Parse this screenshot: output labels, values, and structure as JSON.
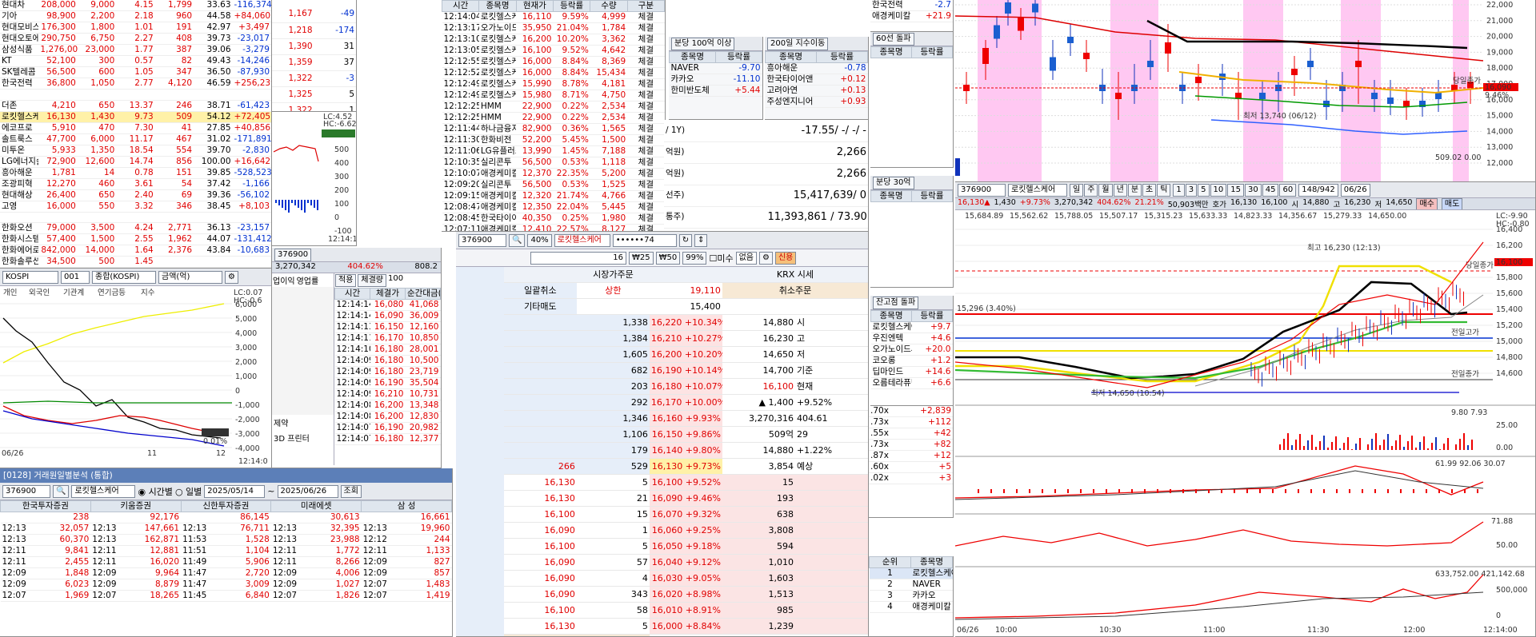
{
  "colors": {
    "up": "#e00000",
    "down": "#0030d0",
    "accent": "#5c7fb8"
  },
  "stocks": {
    "rows": [
      [
        "현대차",
        "208,000",
        "9,000",
        "4.15",
        "1,799",
        "33.63",
        "-116,374"
      ],
      [
        "기아",
        "98,900",
        "2,200",
        "2.18",
        "960",
        "44.58",
        "+84,060"
      ],
      [
        "현대모비스",
        "176,300",
        "1,800",
        "1.01",
        "191",
        "42.97",
        "+3,497"
      ],
      [
        "현대오토에버",
        "290,750",
        "6,750",
        "2.27",
        "408",
        "39.73",
        "-23,017"
      ],
      [
        "삼성식품",
        "1,276,000",
        "23,000",
        "1.77",
        "387",
        "39.06",
        "-3,279"
      ],
      [
        "KT",
        "52,100",
        "300",
        "0.57",
        "82",
        "49.43",
        "-14,246"
      ],
      [
        "SK텔레콤",
        "56,500",
        "600",
        "1.05",
        "347",
        "36.50",
        "-87,930"
      ],
      [
        "한국전력",
        "36,800",
        "1,050",
        "2.77",
        "4,120",
        "46.59",
        "+256,239"
      ],
      [
        "",
        "",
        "",
        "",
        "",
        "",
        ""
      ],
      [
        "더존",
        "4,210",
        "650",
        "13.37",
        "246",
        "38.71",
        "-61,423"
      ],
      [
        "로킷헬스케어",
        "16,130",
        "1,430",
        "9.73",
        "509",
        "54.12",
        "+72,405"
      ],
      [
        "에코프로",
        "5,910",
        "470",
        "7.30",
        "41",
        "27.85",
        "+40,856"
      ],
      [
        "솔트룩스",
        "47,700",
        "6,000",
        "11.17",
        "467",
        "31.02",
        "-171,891"
      ],
      [
        "미투온",
        "5,933",
        "1,350",
        "18.54",
        "554",
        "39.70",
        "-2,830"
      ],
      [
        "LG에너지솔루션",
        "72,900",
        "12,600",
        "14.74",
        "856",
        "100.00",
        "+16,642"
      ],
      [
        "흥아해운",
        "1,781",
        "14",
        "0.78",
        "151",
        "39.85",
        "-528,523"
      ],
      [
        "조광피혁",
        "12,270",
        "460",
        "3.61",
        "54",
        "37.42",
        "-1,166"
      ],
      [
        "현대해상",
        "26,400",
        "650",
        "2.40",
        "69",
        "39.36",
        "-56,102"
      ],
      [
        "고영",
        "16,000",
        "550",
        "3.32",
        "346",
        "38.45",
        "+8,103"
      ],
      [
        "",
        "",
        "",
        "",
        "",
        "",
        ""
      ],
      [
        "한화오션",
        "79,000",
        "3,500",
        "4.24",
        "2,771",
        "36.13",
        "-23,157"
      ],
      [
        "한화시스템",
        "57,400",
        "1,500",
        "2.55",
        "1,962",
        "44.07",
        "-131,412"
      ],
      [
        "한화에어로스페이스",
        "842,000",
        "14,000",
        "1.64",
        "2,376",
        "43.84",
        "-10,683"
      ],
      [
        "한화솔루션",
        "34,500",
        "500",
        "1.45",
        "",
        "",
        ""
      ]
    ],
    "side_vals": [
      [
        "1,167",
        "-49"
      ],
      [
        "1,218",
        "-174"
      ],
      [
        "1,390",
        "31"
      ],
      [
        "1,359",
        "37"
      ],
      [
        "1,322",
        "-3"
      ],
      [
        "1,325",
        "5"
      ],
      [
        "1,322",
        "1"
      ]
    ]
  },
  "mini": {
    "lc": "LC:4.52",
    "hc": "HC:-6.62",
    "px": "16,100",
    "chg": "-0.25%",
    "y": [
      "500",
      "400",
      "300",
      "200",
      "100",
      "0",
      "-100"
    ],
    "time": "12:14:16"
  },
  "ticks": {
    "headers": [
      "시간",
      "종목명",
      "현재가",
      "등락률",
      "수량",
      "구분"
    ],
    "rows": [
      [
        "12:14:04",
        "로킷헬스케어",
        "16,110",
        "9.59%",
        "4,999",
        "체결"
      ],
      [
        "12:13:17",
        "오가노이드사",
        "35,950",
        "21.04%",
        "1,784",
        "체결"
      ],
      [
        "12:13:10",
        "로킷헬스케어",
        "16,200",
        "10.20%",
        "3,362",
        "체결"
      ],
      [
        "12:13:05",
        "로킷헬스케어",
        "16,100",
        "9.52%",
        "4,642",
        "체결"
      ],
      [
        "12:12:55",
        "로킷헬스케어",
        "16,000",
        "8.84%",
        "8,369",
        "체결"
      ],
      [
        "12:12:52",
        "로킷헬스케어",
        "16,000",
        "8.84%",
        "15,434",
        "체결"
      ],
      [
        "12:12:49",
        "로킷헬스케어",
        "15,990",
        "8.78%",
        "4,181",
        "체결"
      ],
      [
        "12:12:49",
        "로킷헬스케어",
        "15,980",
        "8.71%",
        "4,750",
        "체결"
      ],
      [
        "12:12:25",
        "HMM",
        "22,900",
        "0.22%",
        "2,534",
        "체결"
      ],
      [
        "12:12:25",
        "HMM",
        "22,900",
        "0.22%",
        "2,534",
        "체결"
      ],
      [
        "12:11:44",
        "하나금융지주",
        "82,900",
        "0.36%",
        "1,565",
        "체결"
      ],
      [
        "12:11:30",
        "한화비전",
        "52,200",
        "5.45%",
        "1,500",
        "체결"
      ],
      [
        "12:11:06",
        "LG유플러스",
        "13,990",
        "1.45%",
        "7,188",
        "체결"
      ],
      [
        "12:10:35",
        "실리콘투",
        "56,500",
        "0.53%",
        "1,118",
        "체결"
      ],
      [
        "12:10:07",
        "애경케미칼",
        "12,370",
        "22.35%",
        "5,200",
        "체결"
      ],
      [
        "12:09:20",
        "실리콘투",
        "56,500",
        "0.53%",
        "1,525",
        "체결"
      ],
      [
        "12:09:15",
        "애경케미칼",
        "12,320",
        "21.74%",
        "4,766",
        "체결"
      ],
      [
        "12:08:47",
        "애경케미칼",
        "12,350",
        "22.04%",
        "5,445",
        "체결"
      ],
      [
        "12:08:45",
        "한국타이어",
        "40,350",
        "0.25%",
        "1,980",
        "체결"
      ],
      [
        "12:07:11",
        "애경케미칼",
        "12,410",
        "22.57%",
        "8,127",
        "체결"
      ]
    ]
  },
  "rank100": {
    "title": "분당 100억 이상",
    "headers": [
      "종목명",
      "등락률"
    ],
    "rows": [
      [
        "NAVER",
        "-9.70"
      ],
      [
        "카카오",
        "-11.10"
      ],
      [
        "한미반도체",
        "+5.44"
      ]
    ]
  },
  "rank200": {
    "title": "200일 지수이동",
    "headers": [
      "종목명",
      "등락률"
    ],
    "rows": [
      [
        "흥아해운",
        "-0.78"
      ],
      [
        "한국타이어앤",
        "+0.12"
      ],
      [
        "고려아연",
        "+0.13"
      ],
      [
        "주성엔지니어",
        "+0.93"
      ]
    ]
  },
  "top_right": {
    "rows": [
      [
        "한국전력",
        "-2.7"
      ],
      [
        "애경케미칼",
        "+21.9"
      ]
    ],
    "title60": "60선 돌파"
  },
  "infobox": {
    "rows": [
      [
        "/ 1Y)",
        "-17.55/ -/ -/ -"
      ],
      [
        "억원)",
        "2,266"
      ],
      [
        "억원)",
        "2,266"
      ],
      [
        "선주)",
        "15,417,639/ 0"
      ],
      [
        "통주)",
        "11,393,861 / 73.90"
      ]
    ]
  },
  "order": {
    "code": "376900",
    "name": "로킷헬스케어",
    "pct": "40%",
    "qty": "16",
    "pw": "••••••74",
    "m25": "₩25",
    "m50": "₩50",
    "p99": "99%",
    "nooption": "없음",
    "credit": "신용",
    "misu": "미수",
    "header_left": "시장가주문",
    "header_right": "KRX 시세",
    "upper": "상한",
    "upper_px": "19,110",
    "cancel_all": "일괄취소",
    "other_sell": "기타매도",
    "other_sell_px": "15,400",
    "cancel_order": "취소주문",
    "asks": [
      [
        "1,338",
        "16,220",
        "+10.34%"
      ],
      [
        "1,384",
        "16,210",
        "+10.27%"
      ],
      [
        "1,605",
        "16,200",
        "+10.20%"
      ],
      [
        "682",
        "16,190",
        "+10.14%"
      ],
      [
        "203",
        "16,180",
        "+10.07%"
      ],
      [
        "292",
        "16,170",
        "+10.00%"
      ],
      [
        "1,346",
        "16,160",
        "+9.93%"
      ],
      [
        "1,106",
        "16,150",
        "+9.86%"
      ],
      [
        "179",
        "16,140",
        "+9.80%"
      ],
      [
        "529",
        "16,130",
        "+9.73%"
      ]
    ],
    "ask_left": [
      "",
      "",
      "",
      "",
      "",
      "",
      "",
      "",
      "",
      "266"
    ],
    "bids": [
      [
        "16,130",
        "5",
        "16,100",
        "+9.52%",
        "15"
      ],
      [
        "16,130",
        "21",
        "16,090",
        "+9.46%",
        "193"
      ],
      [
        "16,100",
        "15",
        "16,070",
        "+9.32%",
        "638"
      ],
      [
        "16,090",
        "1",
        "16,060",
        "+9.25%",
        "3,808"
      ],
      [
        "16,100",
        "5",
        "16,050",
        "+9.18%",
        "594"
      ],
      [
        "16,090",
        "57",
        "16,040",
        "+9.12%",
        "1,010"
      ],
      [
        "16,090",
        "4",
        "16,030",
        "+9.05%",
        "1,603"
      ],
      [
        "16,090",
        "343",
        "16,020",
        "+8.98%",
        "1,513"
      ],
      [
        "16,100",
        "58",
        "16,010",
        "+8.91%",
        "985"
      ],
      [
        "16,130",
        "5",
        "16,000",
        "+8.84%",
        "1,239"
      ]
    ],
    "quote": [
      [
        "14,880",
        "시"
      ],
      [
        "16,230",
        "고"
      ],
      [
        "14,650",
        "저"
      ],
      [
        "14,700",
        "기준"
      ],
      [
        "16,100",
        "현재"
      ],
      [
        "▲ 1,400",
        "+9.52%"
      ],
      [
        "3,270,316",
        "404.61"
      ],
      [
        "509억",
        "29"
      ],
      [
        "14,880",
        "+1.22%"
      ],
      [
        "3,854",
        "예상"
      ]
    ],
    "side_tabs": [
      "투",
      "거",
      "외",
      "일",
      "차",
      "뉴",
      "권",
      "기"
    ],
    "lower_px": "15,190",
    "other_buy": "기타매수",
    "bottom_px": "10,290",
    "lower": "하한",
    "bottom_cancel": "일괄취소"
  },
  "kospi": {
    "market": "KOSPI",
    "code": "001",
    "index": "종합(KOSPI)",
    "unit": "금액(억)",
    "legend": [
      "개인",
      "외국인",
      "기관계",
      "연기금등",
      "지수"
    ],
    "lc": "LC:0.07",
    "hc": "HC:-0.6",
    "y": [
      "6,000",
      "5,000",
      "4,000",
      "3,000",
      "2,000",
      "1,000",
      "0",
      "-1,000",
      "-2,000",
      "-3,000",
      "-4,000"
    ],
    "date": "06/26",
    "x": [
      "11",
      "12"
    ],
    "last": "3,088",
    "pct": "0.01%",
    "time": "12:14:0"
  },
  "trades": {
    "code": "376900",
    "pct_top": "404.62%",
    "vol_top": "3,270,342",
    "right": "808.2",
    "strength": "100",
    "headers": [
      "시간",
      "체결가",
      "순간대금(천)"
    ],
    "tab_a": "적용",
    "tab_b": "체결량",
    "tab_c": "±t순간거래",
    "rows": [
      [
        "12:14:14",
        "16,080",
        "41,068"
      ],
      [
        "12:14:14",
        "16,090",
        "36,009"
      ],
      [
        "12:14:13",
        "16,150",
        "12,160"
      ],
      [
        "12:14:11",
        "16,170",
        "10,850"
      ],
      [
        "12:14:10",
        "16,180",
        "28,001"
      ],
      [
        "12:14:09",
        "16,180",
        "10,500"
      ],
      [
        "12:14:09",
        "16,180",
        "23,719"
      ],
      [
        "12:14:09",
        "16,190",
        "35,504"
      ],
      [
        "12:14:09",
        "16,210",
        "10,731"
      ],
      [
        "12:14:08",
        "16,200",
        "13,348"
      ],
      [
        "12:14:08",
        "16,200",
        "12,830"
      ],
      [
        "12:14:07",
        "16,190",
        "20,982"
      ],
      [
        "12:14:07",
        "16,180",
        "12,377"
      ]
    ],
    "cond": "조건",
    "list_a": [
      "업이익",
      "영업률"
    ],
    "bottom": [
      "제약",
      "3D 프린터"
    ]
  },
  "broker": {
    "title": "[0128] 거래원일별분석 (통합)",
    "code": "376900",
    "name": "로킷헬스케어",
    "opt_time": "시간별",
    "opt_day": "일별",
    "from": "2025/05/14",
    "to": "2025/06/26",
    "btn": "조회",
    "firms": [
      [
        "한국투자증권",
        "238"
      ],
      [
        "키움증권",
        "92,176"
      ],
      [
        "신한투자증권",
        "86,145"
      ],
      [
        "미래에셋",
        "30,613"
      ],
      [
        "삼 성",
        "16,661"
      ]
    ],
    "rows": [
      [
        "12:13",
        "32,057",
        "12:13",
        "147,661",
        "12:13",
        "76,711",
        "12:13",
        "32,395",
        "12:13",
        "19,960"
      ],
      [
        "12:13",
        "60,370",
        "12:13",
        "162,871",
        "11:53",
        "1,528",
        "12:13",
        "23,988",
        "12:12",
        "244"
      ],
      [
        "12:11",
        "9,841",
        "12:11",
        "12,881",
        "11:51",
        "1,104",
        "12:11",
        "1,772",
        "12:11",
        "1,133"
      ],
      [
        "12:11",
        "2,455",
        "12:11",
        "16,020",
        "11:49",
        "5,906",
        "12:11",
        "8,266",
        "12:09",
        "827"
      ],
      [
        "12:09",
        "1,848",
        "12:09",
        "9,964",
        "11:47",
        "2,720",
        "12:09",
        "4,006",
        "12:09",
        "857"
      ],
      [
        "12:09",
        "6,023",
        "12:09",
        "8,879",
        "11:47",
        "3,009",
        "12:09",
        "1,027",
        "12:07",
        "1,483"
      ],
      [
        "12:07",
        "1,969",
        "12:07",
        "18,265",
        "11:45",
        "6,840",
        "12:07",
        "1,826",
        "12:07",
        "1,419"
      ]
    ]
  },
  "mid_right": {
    "title30": "분당 30억",
    "headers": [
      "종목명",
      "등락률"
    ],
    "title_vol": "잔고점 돌파",
    "rows2": [
      [
        "로킷헬스케어",
        "+9.7"
      ],
      [
        "우진엔텍",
        "+4.6"
      ],
      [
        "오가노이드사",
        "+20.0"
      ],
      [
        "코오롱",
        "+1.2"
      ],
      [
        "딥마인드",
        "+14.6"
      ],
      [
        "오름테라퓨틱",
        "+6.6"
      ]
    ],
    "chg": [
      [
        ".70x",
        "+2,839"
      ],
      [
        ".73x",
        "+112"
      ],
      [
        ".55x",
        "+42"
      ],
      [
        ".73x",
        "+82"
      ],
      [
        ".87x",
        "+12"
      ],
      [
        ".60x",
        "+5"
      ],
      [
        ".02x",
        "+3"
      ]
    ],
    "rank_title": "순위",
    "rank_header": "종목명",
    "rank": [
      [
        "1",
        "로킷헬스케어"
      ],
      [
        "2",
        "NAVER"
      ],
      [
        "3",
        "카카오"
      ],
      [
        "4",
        "애경케미칼"
      ]
    ]
  },
  "topchart": {
    "y": [
      "22,000",
      "21,000",
      "20,000",
      "19,000",
      "18,000",
      "17,000",
      "16,000",
      "15,000",
      "14,000",
      "13,000",
      "12,000"
    ],
    "prev_close": "당일종가",
    "px": "16,090",
    "pct": "9.46%",
    "low_note": "최저 13,740 (06/12)",
    "vol": "509.02 0.00"
  },
  "mainchart": {
    "code": "376900",
    "name": "로킷헬스케어",
    "period": [
      "일",
      "주",
      "월",
      "년",
      "분",
      "초",
      "틱"
    ],
    "nums": [
      "1",
      "3",
      "5",
      "10",
      "15",
      "30",
      "45",
      "60"
    ],
    "count": "148/942",
    "date": "06/26",
    "info": [
      "16,130▲",
      "1,430",
      "+9.73%",
      "3,270,342",
      "404.62%",
      "21.21%",
      "50,903백만",
      "호가",
      "16,130",
      "16,100",
      "시",
      "14,880",
      "고",
      "16,230",
      "저",
      "14,650"
    ],
    "buy": "매수",
    "sell": "매도",
    "other": "보유",
    "ma": [
      "15,684.89",
      "15,562.62",
      "15,788.05",
      "15,507.17",
      "15,315.23",
      "15,633.33",
      "14,823.33",
      "14,356.67",
      "15,279.33",
      "14,650.00"
    ],
    "lc": "LC:-9.90",
    "hc": "HC:-0.80",
    "high_note": "최고 16,230 (12:13)",
    "low_note": "최저 14,650 (10:54)",
    "prev_high": "전일고가",
    "prev_low": "전일종가",
    "today": "당일종가",
    "px": "16,100",
    "left_note": "15,296 (3.40%)",
    "y": [
      "16,400",
      "16,200",
      "16,000",
      "15,800",
      "15,600",
      "15,400",
      "15,200",
      "15,000",
      "14,800",
      "14,600"
    ],
    "sub1": "9.80 7.93",
    "sub1y": [
      "25.00",
      "0.00"
    ],
    "sub2": "61.99 92.06 30.07",
    "sub3": "71.88",
    "sub3y": [
      "50.00"
    ],
    "sub4": "633,752.00 421,142.68",
    "sub4y": [
      "500,000",
      "0"
    ],
    "x": [
      "06/26",
      "10:00",
      "10:30",
      "11:00",
      "11:30",
      "12:00",
      "12:14:00"
    ]
  }
}
